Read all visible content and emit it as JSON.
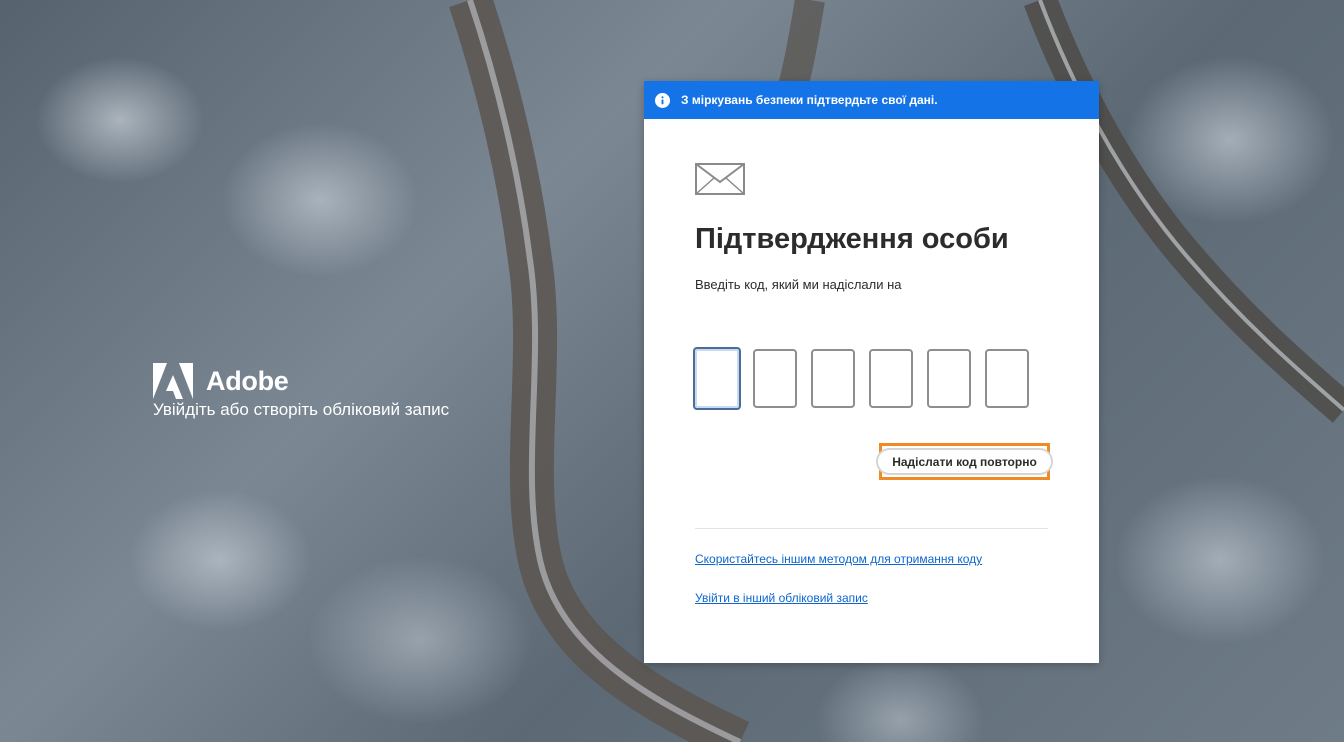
{
  "brand": {
    "name": "Adobe",
    "tagline": "Увійдіть або створіть обліковий запис"
  },
  "banner": {
    "icon": "info-icon",
    "text": "З міркувань безпеки підтвердьте свої дані."
  },
  "card": {
    "icon": "envelope-icon",
    "title": "Підтвердження особи",
    "subtitle": "Введіть код, який ми надіслали на",
    "code_boxes": [
      "",
      "",
      "",
      "",
      "",
      ""
    ],
    "resend_label": "Надіслати код повторно",
    "alt_method_link": "Скористайтесь іншим методом для отримання коду",
    "other_account_link": "Увійти в інший обліковий запис"
  },
  "colors": {
    "banner": "#1473e6",
    "link": "#0d66d0",
    "highlight": "#f08a24"
  }
}
